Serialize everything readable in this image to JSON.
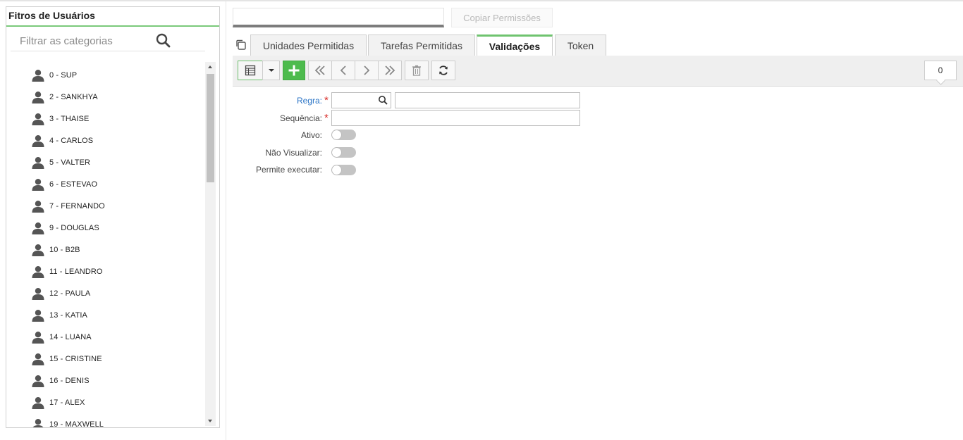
{
  "left_panel": {
    "title": "Fitros de Usuários",
    "search_placeholder": "Filtrar as categorias",
    "users": [
      "0 - SUP",
      "2 - SANKHYA",
      "3 - THAISE",
      "4 - CARLOS",
      "5 - VALTER",
      "6 - ESTEVAO",
      "7 - FERNANDO",
      "9 - DOUGLAS",
      "10 - B2B",
      "11 - LEANDRO",
      "12 - PAULA",
      "13 - KATIA",
      "14 - LUANA",
      "15 - CRISTINE",
      "16 - DENIS",
      "17 - ALEX",
      "19 - MAXWELL"
    ]
  },
  "header": {
    "top_input_value": "",
    "copy_button": "Copiar Permissões"
  },
  "tabs": [
    {
      "label": "Unidades Permitidas",
      "active": false
    },
    {
      "label": "Tarefas Permitidas",
      "active": false
    },
    {
      "label": "Validações",
      "active": true
    },
    {
      "label": "Token",
      "active": false
    }
  ],
  "toolbar": {
    "record_count": "0"
  },
  "form": {
    "regra_label": "Regra:",
    "sequencia_label": "Sequência:",
    "ativo_label": "Ativo:",
    "nao_visualizar_label": "Não Visualizar:",
    "permite_executar_label": "Permite executar:",
    "regra_code": "",
    "regra_description": "",
    "sequencia_value": "",
    "ativo": false,
    "nao_visualizar": false,
    "permite_executar": false
  },
  "colors": {
    "accent_green": "#6fc36f",
    "add_button": "#4dbb4d",
    "required": "#d9302c",
    "link": "#2a74c6"
  }
}
